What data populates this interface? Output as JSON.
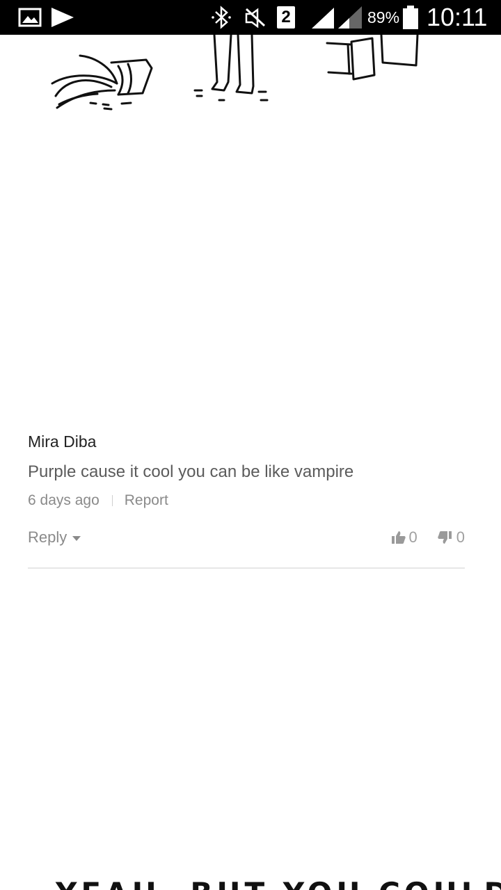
{
  "status_bar": {
    "sim_slot": "2",
    "battery_percent": "89%",
    "time": "10:11",
    "icons": [
      "image-icon",
      "play-store-icon",
      "bluetooth-icon",
      "mute-icon",
      "signal-icon",
      "battery-icon"
    ]
  },
  "comment": {
    "author": "Mira Diba",
    "text": "Purple cause it cool you can be like vampire",
    "time_ago": "6 days ago",
    "report_label": "Report",
    "reply_label": "Reply",
    "upvotes": "0",
    "downvotes": "0"
  },
  "comic": {
    "bottom_caption": "YEAH, BUT YOU COULD BE"
  },
  "colors": {
    "status_bar_bg": "#000000",
    "author": "#222222",
    "body_text": "#5b5b5b",
    "meta_text": "#8a8a8a"
  }
}
